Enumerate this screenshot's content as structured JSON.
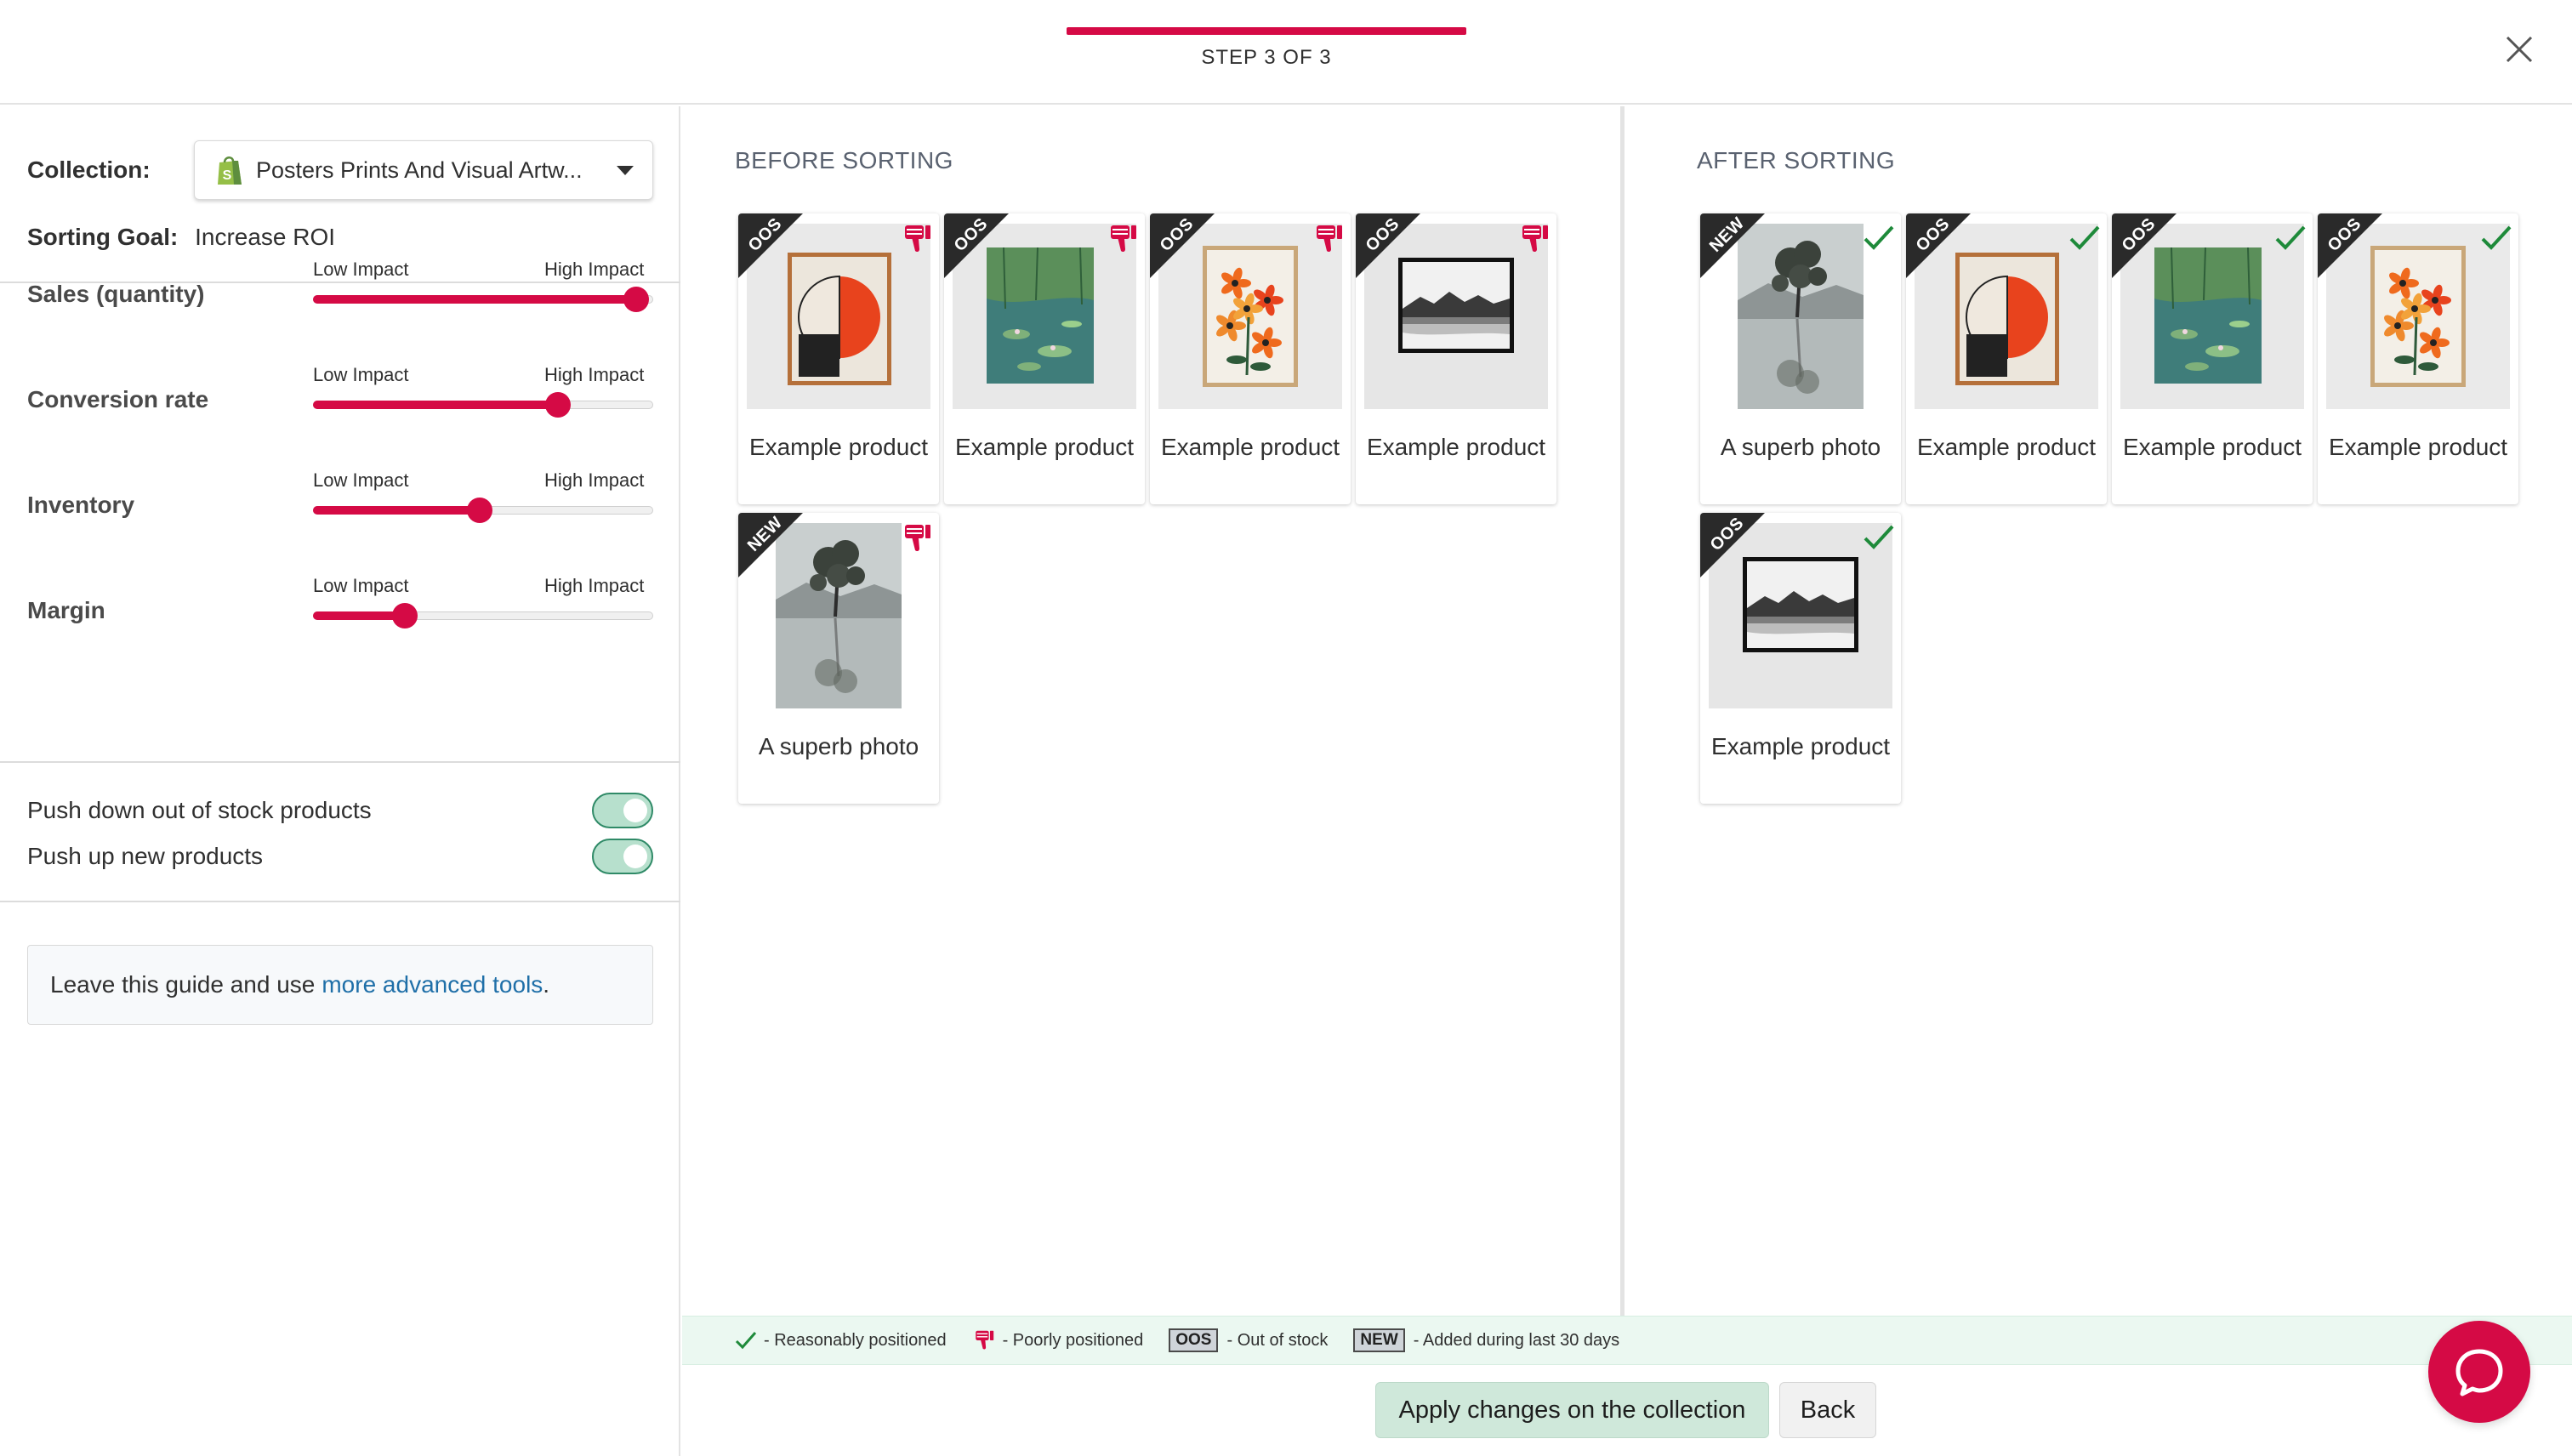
{
  "header": {
    "step_label": "STEP 3 OF 3"
  },
  "sidebar": {
    "collection_label": "Collection:",
    "collection_value": "Posters Prints And Visual Artw...",
    "goal_label": "Sorting Goal:",
    "goal_value": "Increase ROI",
    "factors": [
      {
        "name": "Sales (quantity)",
        "low": "Low Impact",
        "high": "High Impact",
        "level": 0.97
      },
      {
        "name": "Conversion rate",
        "low": "Low Impact",
        "high": "High Impact",
        "level": 0.73
      },
      {
        "name": "Inventory",
        "low": "Low Impact",
        "high": "High Impact",
        "level": 0.49
      },
      {
        "name": "Margin",
        "low": "Low Impact",
        "high": "High Impact",
        "level": 0.26
      }
    ],
    "toggles": [
      {
        "label": "Push down out of stock products",
        "on": true
      },
      {
        "label": "Push up new products",
        "on": true
      }
    ],
    "leave_text": "Leave this guide and use",
    "leave_link": "more advanced tools",
    "leave_suffix": "."
  },
  "before": {
    "title": "BEFORE SORTING",
    "products": [
      {
        "name": "Example product",
        "badge": "OOS",
        "status": "poor",
        "art": "circle"
      },
      {
        "name": "Example product",
        "badge": "OOS",
        "status": "poor",
        "art": "lily"
      },
      {
        "name": "Example product",
        "badge": "OOS",
        "status": "poor",
        "art": "flowers"
      },
      {
        "name": "Example product",
        "badge": "OOS",
        "status": "poor",
        "art": "mountain"
      },
      {
        "name": "A superb photo",
        "badge": "NEW",
        "status": "poor",
        "art": "tree"
      }
    ]
  },
  "after": {
    "title": "AFTER SORTING",
    "products": [
      {
        "name": "A superb photo",
        "badge": "NEW",
        "status": "good",
        "art": "tree"
      },
      {
        "name": "Example product",
        "badge": "OOS",
        "status": "good",
        "art": "circle"
      },
      {
        "name": "Example product",
        "badge": "OOS",
        "status": "good",
        "art": "lily"
      },
      {
        "name": "Example product",
        "badge": "OOS",
        "status": "good",
        "art": "flowers"
      },
      {
        "name": "Example product",
        "badge": "OOS",
        "status": "good",
        "art": "mountain"
      }
    ]
  },
  "legend": {
    "good": "- Reasonably positioned",
    "poor": "- Poorly positioned",
    "oos_tag": "OOS",
    "oos": "- Out of stock",
    "new_tag": "NEW",
    "new": "- Added during last 30 days"
  },
  "footer": {
    "apply_label": "Apply changes on the collection",
    "back_label": "Back"
  },
  "colors": {
    "accent": "#d50a45",
    "good": "#1e8a3a",
    "legend_bg": "#ebf8f1"
  }
}
